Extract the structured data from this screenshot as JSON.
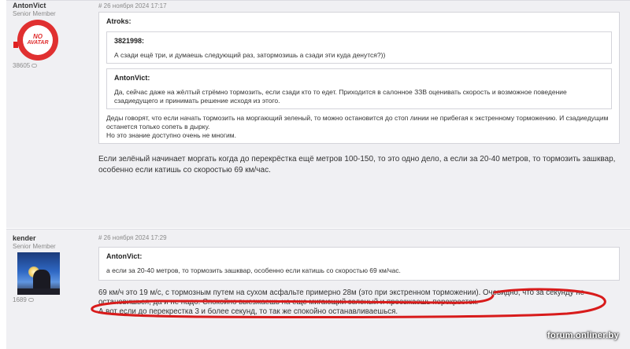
{
  "posts": [
    {
      "author": "AntonVict",
      "rank": "Senior Member",
      "count": "38605",
      "avatar_line1": "NO",
      "avatar_line2": "AVATAR",
      "date": "# 26 ноября 2024 17:17",
      "quote_author": "Atroks:",
      "nested_quotes": [
        {
          "author": "3821998:",
          "text": "А сзади ещё три, и думаешь следующий раз, затормозишь а сзади эти куда денутся?))"
        },
        {
          "author": "AntonVict:",
          "text": "Да, сейчас даже на жёлтый стрёмно тормозить, если сзади кто то едет. Приходится в салонное ЗЗВ оценивать скорость и возможное поведение сзадиедущего и принимать решение исходя из этого."
        }
      ],
      "quote_text_1": "Деды говорят, что если начать тормозить на моргающий зеленый, то можно остановится до стоп линии не прибегая к экстренному торможению. И сзадиедущим останется только сопеть в дырку.",
      "quote_text_2": "Но это знание доступно очень не многим.",
      "message": "Если зелёный начинает моргать когда до перекрёстка ещё метров 100-150, то это одно дело, а если за 20-40 метров, то тормозить зашквар, особенно если катишь со скоростью 69 км/час."
    },
    {
      "author": "kender",
      "rank": "Senior Member",
      "count": "1689",
      "date": "# 26 ноября 2024 17:29",
      "quote_author": "AntonVict:",
      "quote_text": "а если за 20-40 метров, то тормозить зашквар, особенно если катишь со скоростью 69 км/час.",
      "message_part1": "69 км/ч это 19 м/с, с тормозным путем на сухом асфальте примерно 28м (это при экстренном торможении).",
      "message_highlight": "Очевидно, что за секунду не остановишься, да и не надо. Спокойно выезжаешь на еще мигающий зеленый и проезжаешь перекресток.",
      "message_line3": "А вот если до перекрестка 3 и более секунд, то так же спокойно останавливаешься."
    }
  ],
  "watermark": "forum.onliner.by",
  "colors": {
    "highlight": "#d81b1b",
    "avatar_red": "#e03030",
    "post_bg": "#f0f0f3"
  }
}
